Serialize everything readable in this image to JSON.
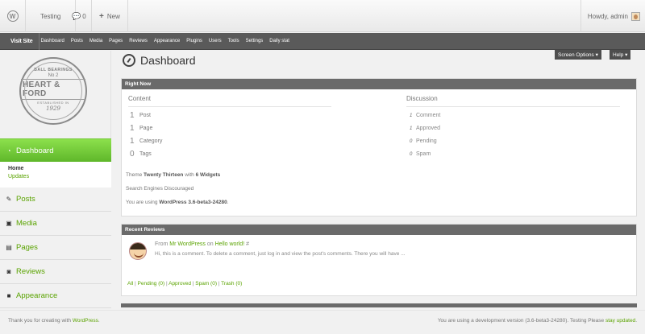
{
  "adminbar": {
    "site_name": "Testing",
    "comment_count": "0",
    "new_label": "New",
    "howdy": "Howdy, admin"
  },
  "menubar": {
    "visit_site": "Visit Site",
    "items": [
      "Dashboard",
      "Posts",
      "Media",
      "Pages",
      "Reviews",
      "Appearance",
      "Plugins",
      "Users",
      "Tools",
      "Settings",
      "Daily stat"
    ]
  },
  "brand": {
    "line1": "BALL BEARINGS",
    "line2": "No 2",
    "line3": "HEART & FORD",
    "line4": "ESTABLISHED IN",
    "line5": "1929"
  },
  "sidebar": {
    "active": "Dashboard",
    "submenu": {
      "home": "Home",
      "updates": "Updates"
    },
    "items": [
      {
        "label": "Posts",
        "icon": "pin-icon"
      },
      {
        "label": "Media",
        "icon": "media-icon"
      },
      {
        "label": "Pages",
        "icon": "pages-icon"
      },
      {
        "label": "Reviews",
        "icon": "comments-icon"
      },
      {
        "label": "Appearance",
        "icon": "appearance-icon"
      }
    ]
  },
  "page": {
    "title": "Dashboard",
    "screen_options": "Screen Options ▾",
    "help": "Help ▾"
  },
  "right_now": {
    "heading": "Right Now",
    "content_heading": "Content",
    "discussion_heading": "Discussion",
    "content": [
      {
        "count": "1",
        "label": "Post"
      },
      {
        "count": "1",
        "label": "Page"
      },
      {
        "count": "1",
        "label": "Category"
      },
      {
        "count": "0",
        "label": "Tags"
      }
    ],
    "discussion": [
      {
        "count": "1",
        "label": "Comment"
      },
      {
        "count": "1",
        "label": "Approved"
      },
      {
        "count": "0",
        "label": "Pending"
      },
      {
        "count": "0",
        "label": "Spam"
      }
    ],
    "theme_prefix": "Theme ",
    "theme_name": "Twenty Thirteen",
    "theme_with": " with ",
    "widgets": "6 Widgets",
    "search_engines": "Search Engines Discouraged",
    "version_prefix": "You are using ",
    "version": "WordPress 3.6-beta3-24280",
    "version_suffix": "."
  },
  "recent_reviews": {
    "heading": "Recent Reviews",
    "from_prefix": "From ",
    "author": "Mr WordPress",
    "on": " on ",
    "post": "Hello world!",
    "hash": " #",
    "excerpt": "Hi, this is a comment. To delete a comment, just log in and view the post's comments. There you will have ...",
    "links": [
      "All",
      "Pending (0)",
      "Approved",
      "Spam (0)",
      "Trash (0)"
    ],
    "sep": " | "
  },
  "footer": {
    "left_prefix": "Thank you for creating with ",
    "left_link": "WordPress",
    "left_suffix": ".",
    "right_prefix": "You are using a development version (3.6-beta3-24280). Testing Please ",
    "right_link": "stay updated",
    "right_suffix": "."
  },
  "colors": {
    "accent_green": "#5aa300",
    "active_green": "#6cc434",
    "dark_bar": "#5a5a5a"
  }
}
